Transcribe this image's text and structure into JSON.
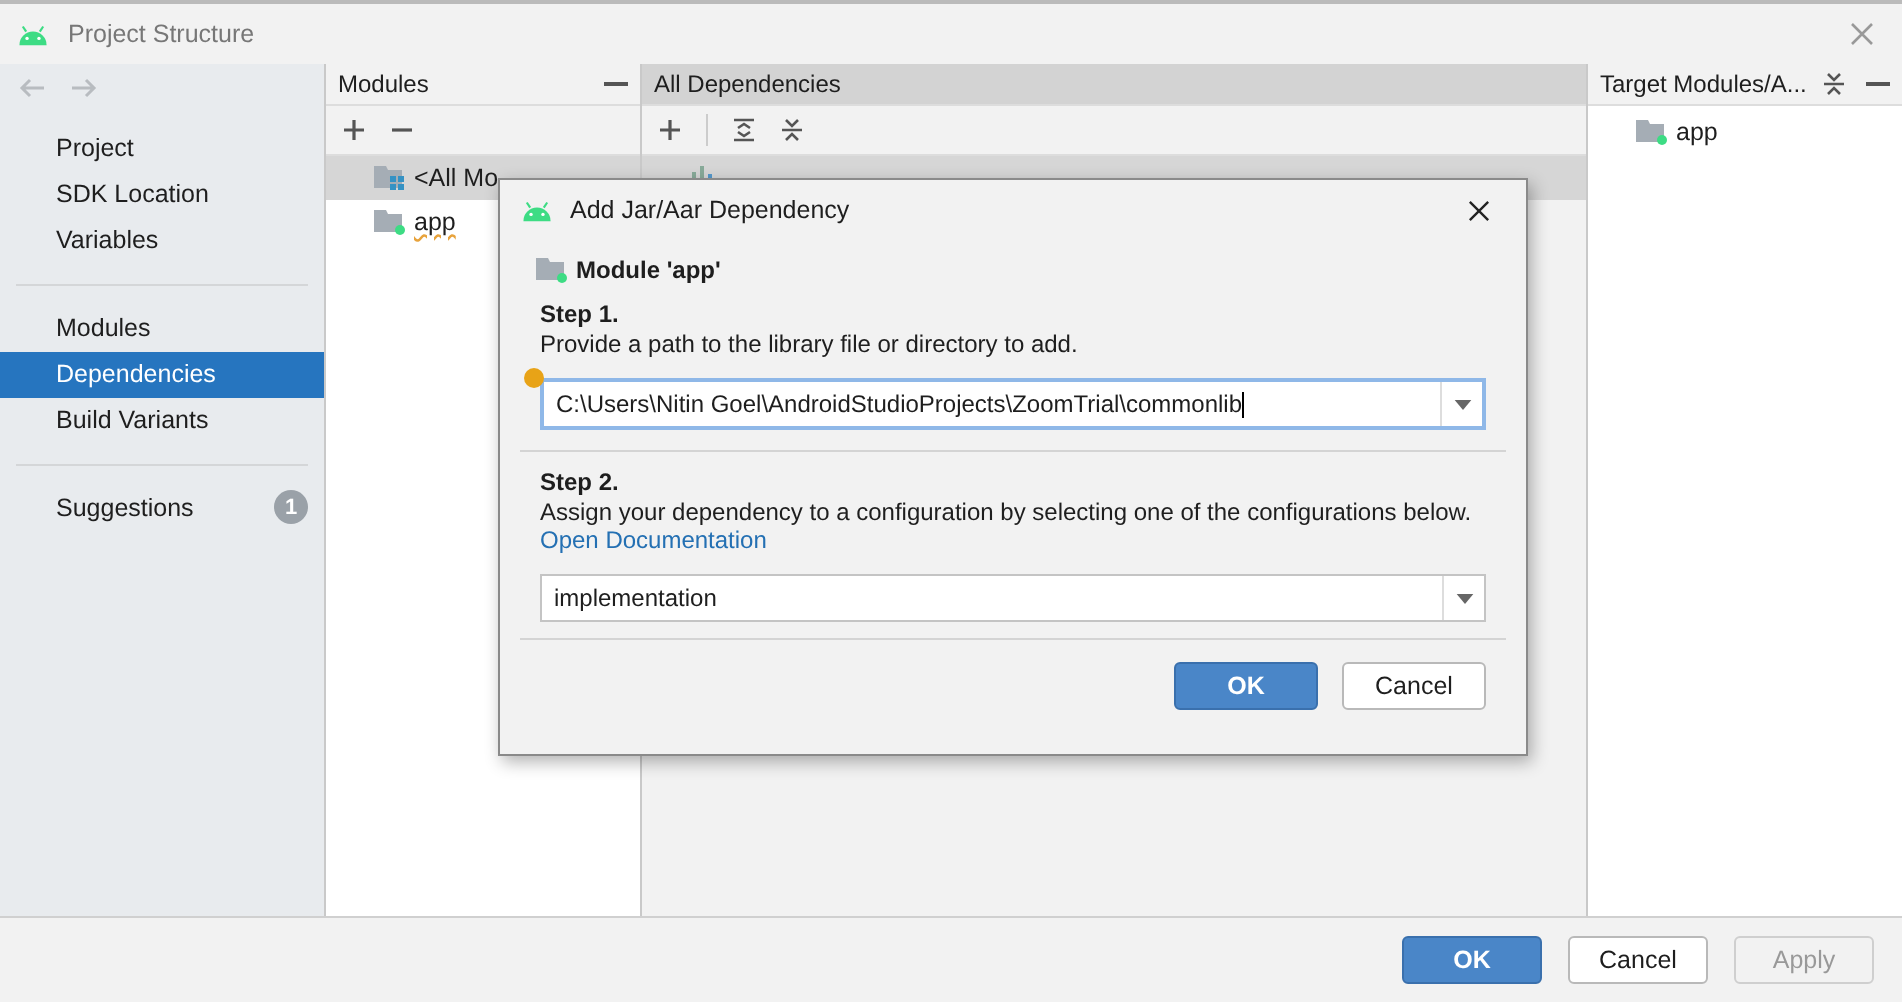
{
  "window": {
    "title": "Project Structure"
  },
  "sidebar": {
    "groups": [
      {
        "items": [
          {
            "label": "Project",
            "selected": false
          },
          {
            "label": "SDK Location",
            "selected": false
          },
          {
            "label": "Variables",
            "selected": false
          }
        ]
      },
      {
        "items": [
          {
            "label": "Modules",
            "selected": false
          },
          {
            "label": "Dependencies",
            "selected": true
          },
          {
            "label": "Build Variants",
            "selected": false
          }
        ]
      }
    ],
    "suggestions": {
      "label": "Suggestions",
      "badge": "1"
    }
  },
  "modules_panel": {
    "title": "Modules",
    "items": [
      {
        "label": "<All Mo",
        "kind": "all",
        "selected": true
      },
      {
        "label": "app",
        "kind": "module",
        "selected": false
      }
    ]
  },
  "dependencies_panel": {
    "title": "All Dependencies"
  },
  "target_panel": {
    "title": "Target Modules/A...",
    "items": [
      "app"
    ]
  },
  "dialog": {
    "title": "Add Jar/Aar Dependency",
    "module": "Module 'app'",
    "step1": {
      "heading": "Step 1.",
      "text": "Provide a path to the library file or directory to add.",
      "value": "C:\\Users\\Nitin Goel\\AndroidStudioProjects\\ZoomTrial\\commonlib"
    },
    "step2": {
      "heading": "Step 2.",
      "text": "Assign your dependency to a configuration by selecting one of the configurations below.",
      "link": "Open Documentation",
      "value": "implementation"
    },
    "buttons": [
      {
        "label": "OK",
        "kind": "primary"
      },
      {
        "label": "Cancel",
        "kind": "normal"
      }
    ]
  },
  "footer": {
    "buttons": [
      {
        "label": "OK",
        "kind": "primary",
        "disabled": false
      },
      {
        "label": "Cancel",
        "kind": "normal",
        "disabled": false
      },
      {
        "label": "Apply",
        "kind": "normal",
        "disabled": true
      }
    ]
  }
}
